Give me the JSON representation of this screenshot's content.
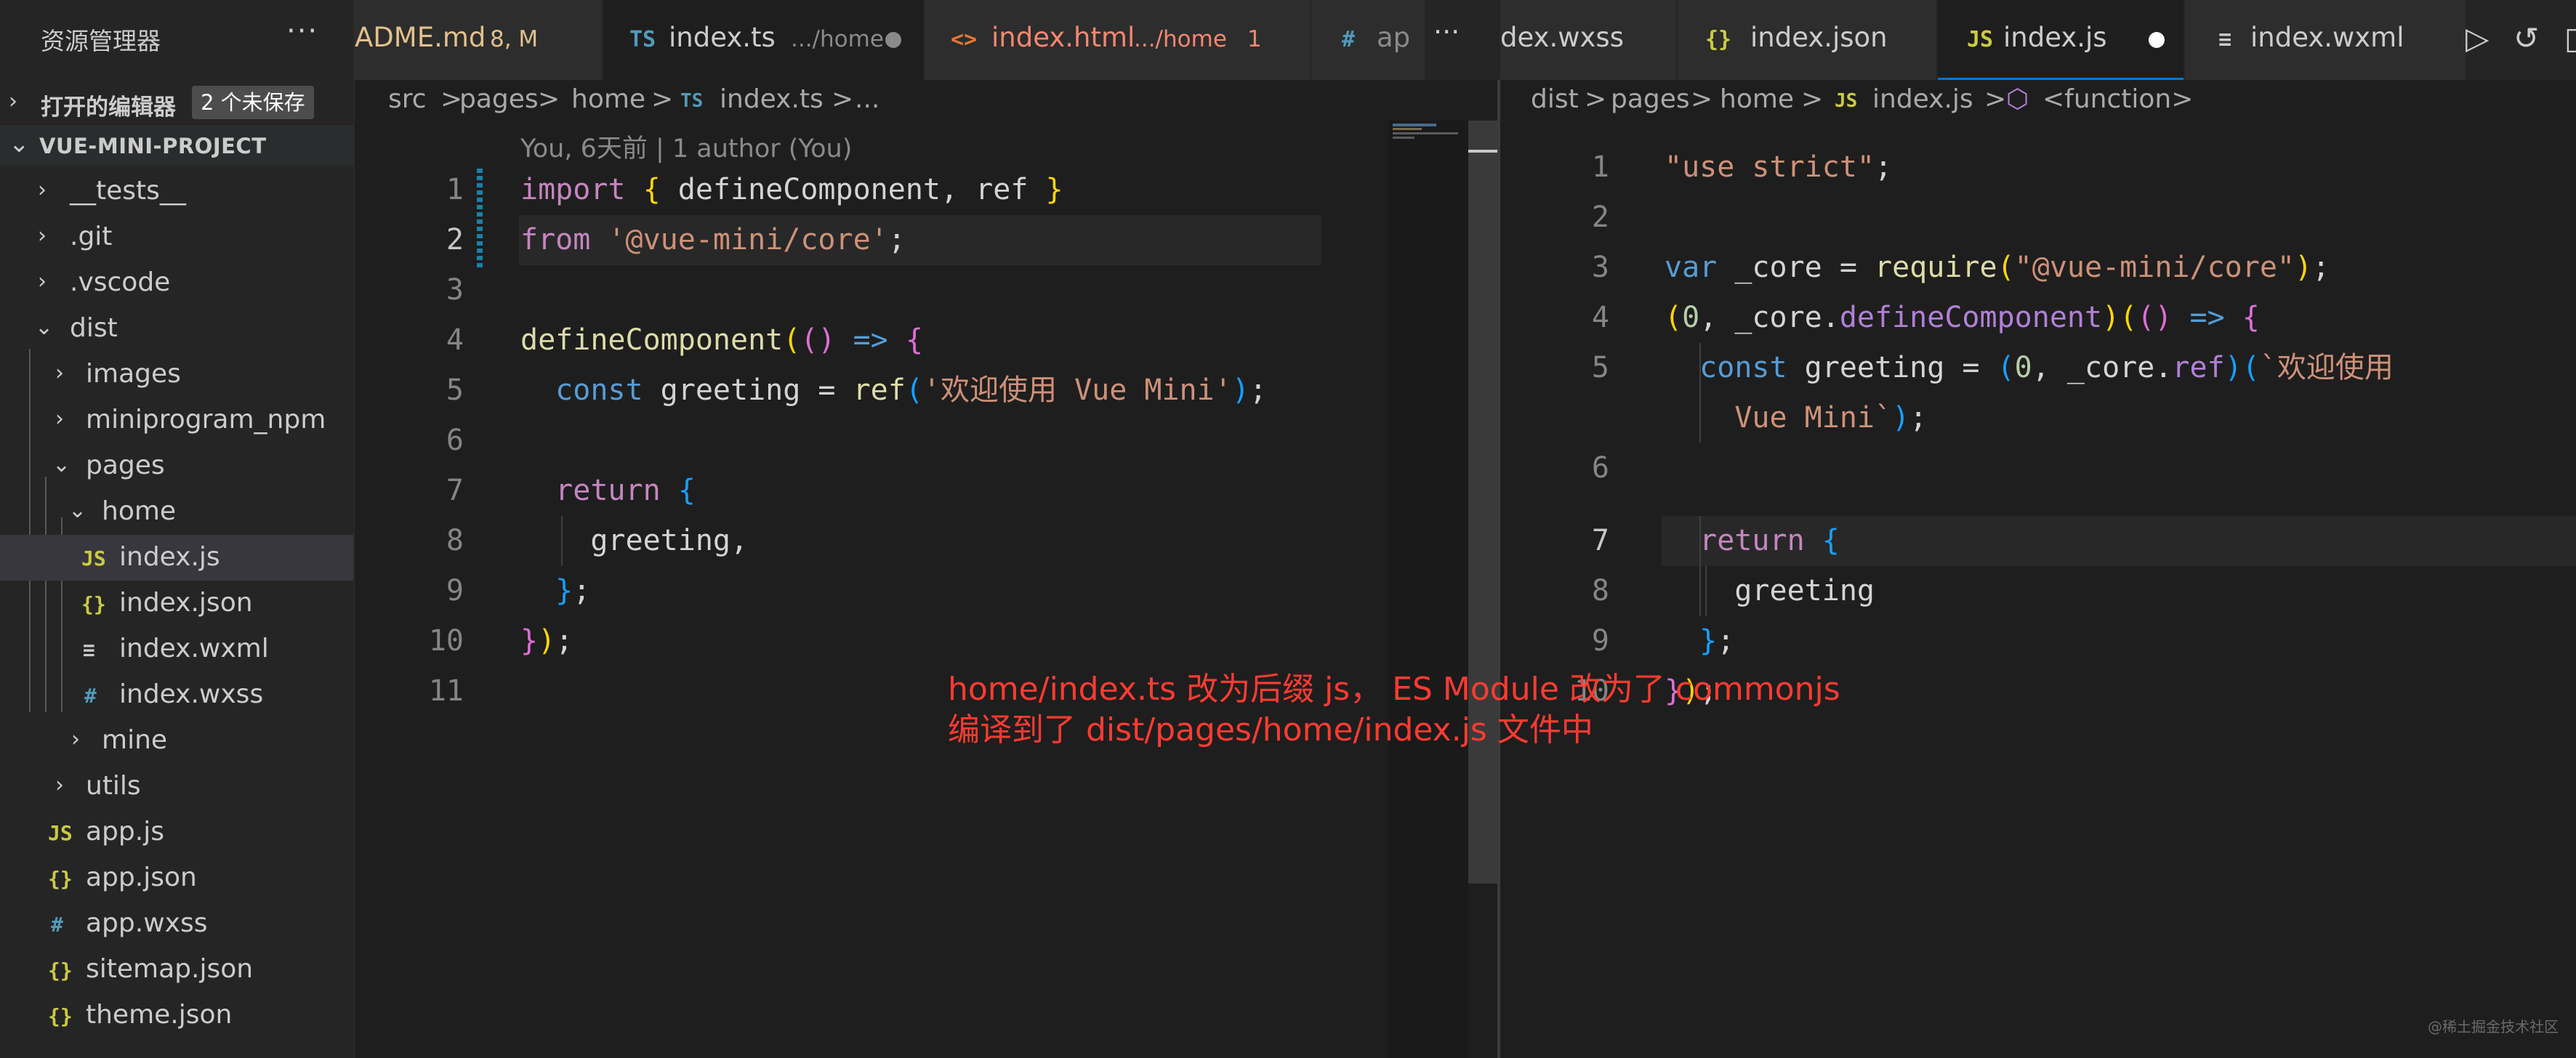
{
  "sidebar": {
    "title": "资源管理器",
    "more": "···",
    "open_editors": {
      "label": "打开的编辑器",
      "badge": "2 个未保存"
    },
    "project": {
      "label": "VUE-MINI-PROJECT"
    },
    "tree": [
      {
        "label": "__tests__",
        "type": "folder",
        "state": "closed"
      },
      {
        "label": ".git",
        "type": "folder",
        "state": "closed"
      },
      {
        "label": ".vscode",
        "type": "folder",
        "state": "closed"
      },
      {
        "label": "dist",
        "type": "folder",
        "state": "open"
      },
      {
        "label": "images",
        "type": "folder",
        "state": "closed"
      },
      {
        "label": "miniprogram_npm",
        "type": "folder",
        "state": "closed"
      },
      {
        "label": "pages",
        "type": "folder",
        "state": "open"
      },
      {
        "label": "home",
        "type": "folder",
        "state": "open"
      },
      {
        "label": "index.js",
        "type": "js",
        "icon": "JS",
        "selected": true
      },
      {
        "label": "index.json",
        "type": "json",
        "icon": "{}"
      },
      {
        "label": "index.wxml",
        "type": "wxml",
        "icon": "≡"
      },
      {
        "label": "index.wxss",
        "type": "wxss",
        "icon": "#"
      },
      {
        "label": "mine",
        "type": "folder",
        "state": "closed"
      },
      {
        "label": "utils",
        "type": "folder",
        "state": "closed"
      },
      {
        "label": "app.js",
        "type": "js",
        "icon": "JS"
      },
      {
        "label": "app.json",
        "type": "json",
        "icon": "{}"
      },
      {
        "label": "app.wxss",
        "type": "wxss",
        "icon": "#"
      },
      {
        "label": "sitemap.json",
        "type": "json",
        "icon": "{}"
      },
      {
        "label": "theme.json",
        "type": "json",
        "icon": "{}"
      }
    ]
  },
  "left_tabs": [
    {
      "name": "ADME.md",
      "badge": "8, M"
    },
    {
      "icon": "TS",
      "name": "index.ts",
      "desc": ".../home"
    },
    {
      "icon": "<>",
      "name": "index.html",
      "desc": ".../home",
      "badge": "1"
    },
    {
      "icon": "#",
      "name": "ap"
    }
  ],
  "left_tabs_more": "···",
  "right_tabs": [
    {
      "name": "dex.wxss"
    },
    {
      "icon": "{}",
      "name": "index.json"
    },
    {
      "icon": "JS",
      "name": "index.js"
    },
    {
      "icon": "≡",
      "name": "index.wxml"
    }
  ],
  "toolbar": {
    "run_icon": "▷",
    "history_icon": "↺"
  },
  "left_breadcrumb": [
    "src",
    ">",
    "pages",
    ">",
    "home",
    ">",
    "TS",
    "index.ts",
    ">",
    "..."
  ],
  "right_breadcrumb": [
    "dist",
    ">",
    "pages",
    ">",
    "home",
    ">",
    "JS",
    "index.js",
    ">",
    "⬡",
    "<function>"
  ],
  "blame": "You, 6天前 | 1 author (You)",
  "left_code": {
    "line_numbers": [
      "1",
      "2",
      "3",
      "4",
      "5",
      "6",
      "7",
      "8",
      "9",
      "10",
      "11"
    ],
    "line1": {
      "a": "import",
      "b": " { ",
      "c": "defineComponent",
      "d": ", ",
      "e": "ref",
      "f": " }"
    },
    "line2": {
      "a": "from",
      "b": " ",
      "c": "'@vue-mini/core'",
      "d": ";"
    },
    "line4": {
      "a": "defineComponent",
      "b": "(",
      "c": "()",
      "d": " => ",
      "e": "{"
    },
    "line5": {
      "a": "  const",
      "b": " greeting = ",
      "c": "ref",
      "d": "(",
      "e": "'欢迎使用 Vue Mini'",
      "f": ")",
      "g": ";"
    },
    "line7": {
      "a": "  return",
      "b": " {"
    },
    "line8": {
      "a": "    greeting,"
    },
    "line9": {
      "a": "  }",
      "b": ";"
    },
    "line10": {
      "a": "}",
      "b": ")",
      "c": ";"
    }
  },
  "right_code": {
    "line_numbers": [
      "1",
      "2",
      "3",
      "4",
      "5",
      "6",
      "7",
      "8",
      "9",
      "10"
    ],
    "line1": {
      "a": "\"use strict\"",
      "b": ";"
    },
    "line3": {
      "a": "var",
      "b": " _core = ",
      "c": "require",
      "d": "(",
      "e": "\"@vue-mini/core\"",
      "f": ")",
      "g": ";"
    },
    "line4": {
      "a": "(",
      "b": "0",
      "c": ", _core.",
      "d": "defineComponent",
      "e": ")",
      "f": "(",
      "g": "()",
      "h": " => ",
      "i": "{"
    },
    "line5": {
      "a": "  const",
      "b": " greeting = ",
      "c": "(",
      "d": "0",
      "e": ", _core.",
      "f": "ref",
      "g": ")",
      "h": "(",
      "i": "`欢迎使用"
    },
    "line6": {
      "a": "    Vue Mini`",
      "b": ")",
      "c": ";"
    },
    "line7": {
      "a": "  return",
      "b": " {"
    },
    "line8": {
      "a": "    greeting"
    },
    "line9": {
      "a": "  }",
      "b": ";"
    },
    "line10": {
      "a": "}",
      "b": ")",
      "c": ";"
    }
  },
  "annotation": {
    "line1": "home/index.ts 改为后缀 js， ES Module 改为了 commonjs",
    "line2": "编译到了 dist/pages/home/index.js 文件中"
  },
  "watermark": "@稀土掘金技术社区"
}
